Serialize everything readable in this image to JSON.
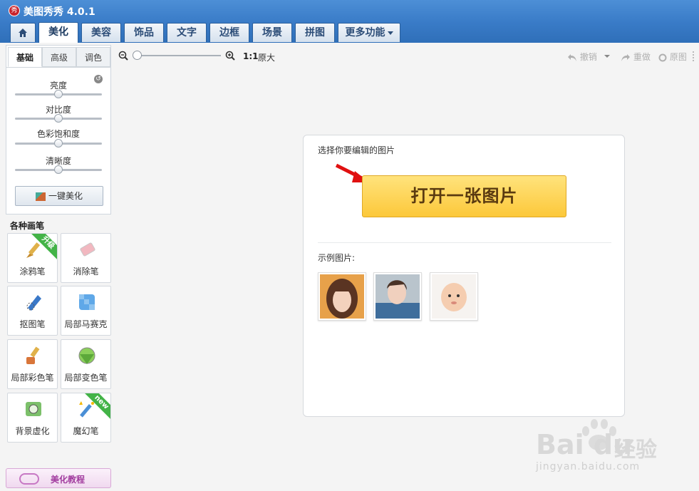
{
  "app": {
    "logo_text": "秀",
    "title": "美图秀秀 4.0.1"
  },
  "tabs": [
    {
      "label": "美化"
    },
    {
      "label": "美容"
    },
    {
      "label": "饰品"
    },
    {
      "label": "文字"
    },
    {
      "label": "边框"
    },
    {
      "label": "场景"
    },
    {
      "label": "拼图"
    },
    {
      "label": "更多功能"
    }
  ],
  "left_panel": {
    "subtabs": [
      "基础",
      "高级",
      "调色"
    ],
    "sliders": [
      {
        "label": "亮度",
        "value": 0.5
      },
      {
        "label": "对比度",
        "value": 0.5
      },
      {
        "label": "色彩饱和度",
        "value": 0.5
      },
      {
        "label": "清晰度",
        "value": 0.5
      }
    ],
    "one_key_label": "一键美化",
    "section_title": "各种画笔",
    "brushes": [
      {
        "label": "涂鸦笔",
        "icon": "paintbrush-icon",
        "badge": "升级"
      },
      {
        "label": "消除笔",
        "icon": "eraser-icon",
        "badge": ""
      },
      {
        "label": "抠图笔",
        "icon": "cutout-pen-icon",
        "badge": ""
      },
      {
        "label": "局部马赛克",
        "icon": "mosaic-icon",
        "badge": ""
      },
      {
        "label": "局部彩色笔",
        "icon": "color-brush-icon",
        "badge": ""
      },
      {
        "label": "局部变色笔",
        "icon": "color-change-icon",
        "badge": ""
      },
      {
        "label": "背景虚化",
        "icon": "blur-background-icon",
        "badge": ""
      },
      {
        "label": "魔幻笔",
        "icon": "magic-wand-icon",
        "badge": "new"
      }
    ],
    "tutorial_label": "美化教程"
  },
  "toolbar": {
    "zoom_level": 0,
    "one_to_one": "1:1",
    "original_size": "原大",
    "undo": "撤销",
    "redo": "重做",
    "original": "原图"
  },
  "card": {
    "prompt": "选择你要编辑的图片",
    "open_button": "打开一张图片",
    "samples_label": "示例图片:",
    "samples": [
      "sample-photo-1",
      "sample-photo-2",
      "sample-photo-3"
    ]
  },
  "watermark": {
    "logo": "Bai du",
    "brand": "经验",
    "url": "jingyan.baidu.com"
  },
  "colors": {
    "title_bar": "#3a7cc8",
    "open_button": "#fcc83a",
    "ribbon_green": "#43b347",
    "tutorial": "#a13b9e"
  }
}
